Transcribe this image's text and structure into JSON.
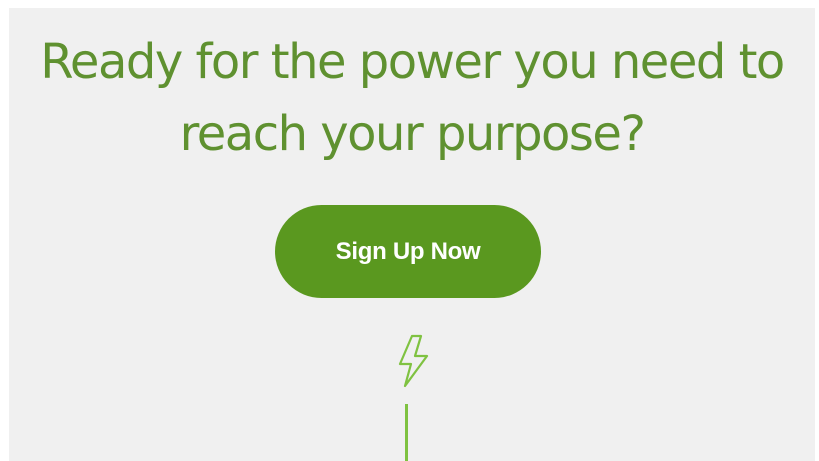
{
  "headline": {
    "line1": "Ready for the power you need to",
    "line2": "reach your purpose?"
  },
  "cta": {
    "label": "Sign Up Now"
  },
  "icons": {
    "bolt": "lightning-bolt-icon"
  },
  "colors": {
    "panel_background": "#f0f0f0",
    "headline_text": "#5f9130",
    "button_background": "#5a981f",
    "button_text": "#ffffff",
    "accent_line": "#7fc241"
  }
}
